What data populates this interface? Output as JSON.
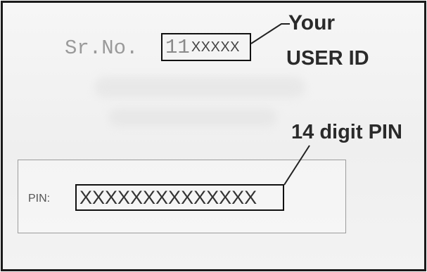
{
  "serial": {
    "label": "Sr.No.",
    "user_id_prefix": "11",
    "user_id_mask": "XXXXX"
  },
  "callouts": {
    "user_id_line1": "Your",
    "user_id_line2": "USER ID",
    "pin": "14 digit PIN"
  },
  "pin": {
    "label": "PIN:",
    "value": "XXXXXXXXXXXXXX"
  }
}
